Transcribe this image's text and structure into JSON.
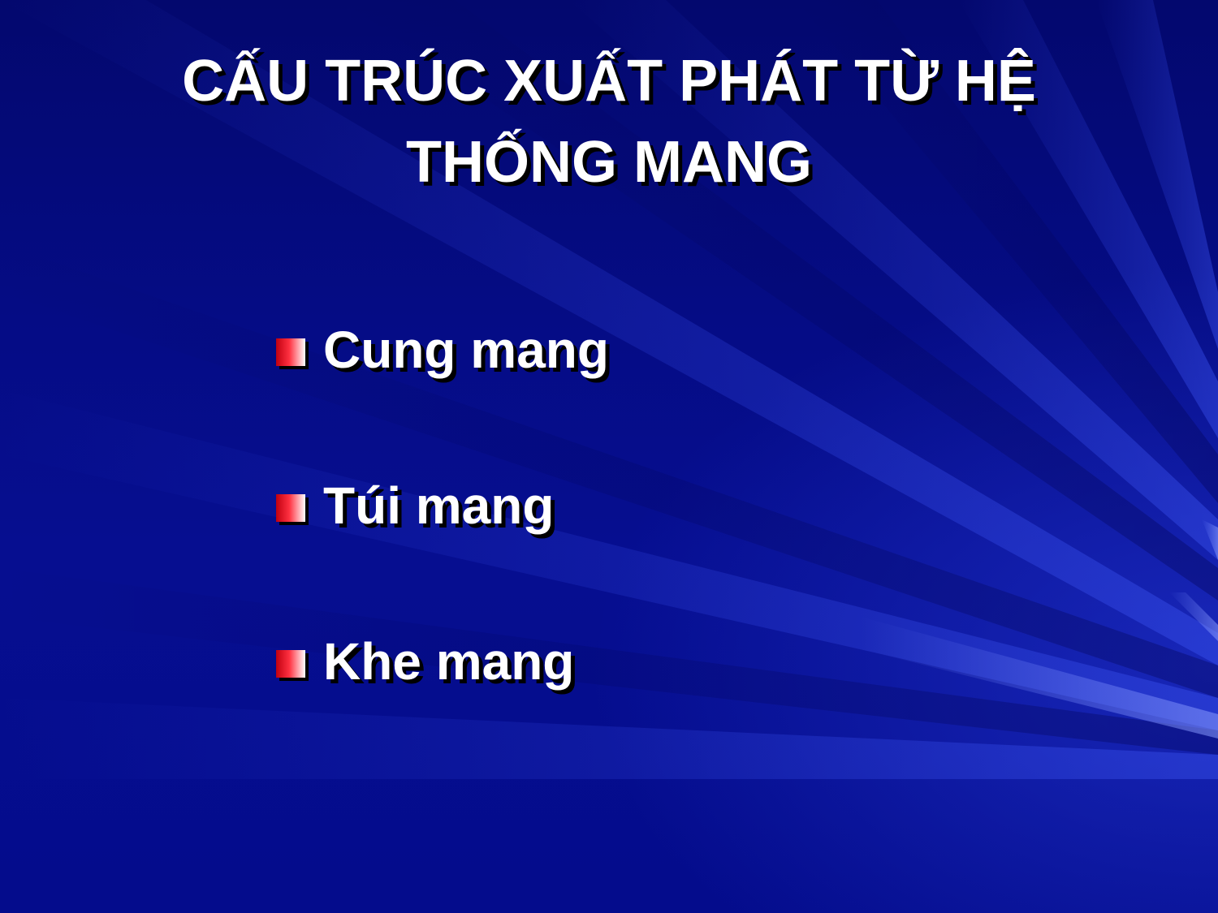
{
  "slide": {
    "title_line1": "CẤU TRÚC XUẤT PHÁT TỪ HỆ",
    "title_line2": "THỐNG MANG",
    "bullets": [
      {
        "text": "Cung mang"
      },
      {
        "text": "Túi mang"
      },
      {
        "text": "Khe mang"
      }
    ]
  },
  "colors": {
    "background": "#050c85",
    "text": "#ffffff",
    "bullet_marker": "#ff3040"
  }
}
